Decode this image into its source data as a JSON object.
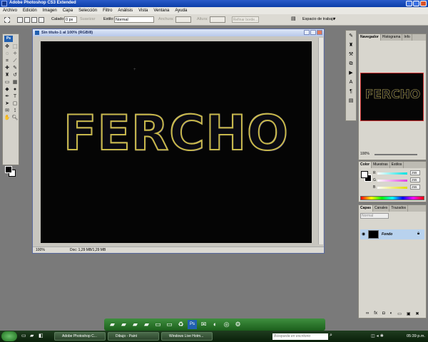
{
  "window": {
    "title": "Adobe Photoshop CS3 Extended"
  },
  "menu": [
    "Archivo",
    "Edición",
    "Imagen",
    "Capa",
    "Selección",
    "Filtro",
    "Análisis",
    "Vista",
    "Ventana",
    "Ayuda"
  ],
  "options": {
    "calado_label": "Calado:",
    "calado_value": "0 px",
    "suavizar_label": "Suavizar",
    "estilo_label": "Estilo:",
    "estilo_value": "Normal",
    "anchura_label": "Anchura:",
    "altura_label": "Altura:",
    "refine_label": "Refinar borde...",
    "workspace_label": "Espacio de trabajo"
  },
  "document": {
    "title": "Sin título-1 al 100% (RGB/8)",
    "canvas_text": "FERCHO",
    "zoom": "100%",
    "doc_size": "Doc: 1,29 MB/1,29 MB"
  },
  "navigator": {
    "tabs": [
      "Navegador",
      "Histograma",
      "Info"
    ],
    "zoom": "100%",
    "thumb_text": "FERCHO"
  },
  "color_panel": {
    "tabs": [
      "Color",
      "Muestras",
      "Estilos"
    ],
    "channels": [
      {
        "name": "R",
        "value": "255",
        "color": "#00e0e0"
      },
      {
        "name": "G",
        "value": "255",
        "color": "#e040e0"
      },
      {
        "name": "B",
        "value": "255",
        "color": "#e0e000"
      }
    ]
  },
  "layers_panel": {
    "tabs": [
      "Capas",
      "Canales",
      "Trazados"
    ],
    "blend_mode": "Normal",
    "layer_name": "Fondo"
  },
  "taskbar": {
    "buttons": [
      "Adobe Photoshop C...",
      "Dibujo - Paint",
      "Windows Live Hotm..."
    ],
    "search_placeholder": "Búsqueda en escritorio",
    "clock": "05:39 p.m."
  }
}
